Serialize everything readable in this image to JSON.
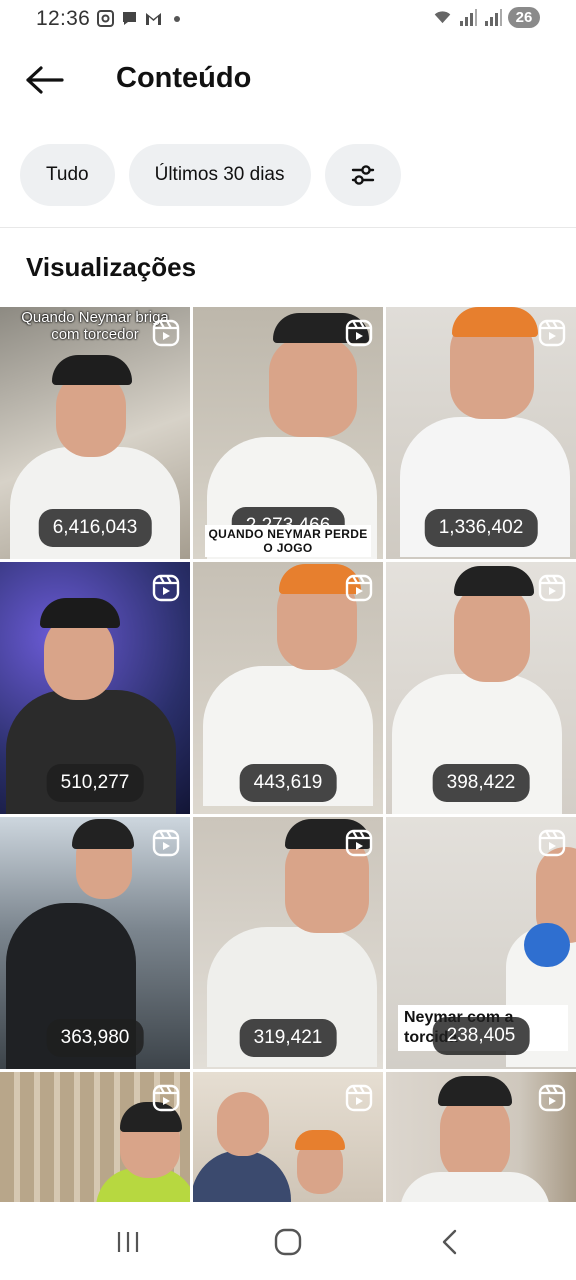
{
  "status_bar": {
    "time": "12:36",
    "battery": "26",
    "icons": [
      "screenshot-icon",
      "chat-icon",
      "gmail-icon",
      "wifi-icon",
      "signal-icon",
      "signal-icon"
    ]
  },
  "header": {
    "title": "Conteúdo",
    "back_icon": "arrow-left-icon"
  },
  "filters": {
    "all_label": "Tudo",
    "period_label": "Últimos 30 dias",
    "settings_icon": "sliders-icon"
  },
  "section": {
    "title": "Visualizações"
  },
  "tiles": [
    {
      "views": "6,416,043",
      "caption_top": "Quando Neymar briga com torcedor",
      "bg": "#b9b3a8"
    },
    {
      "views": "2,273,466",
      "caption_bottom": "QUANDO NEYMAR PERDE O JOGO",
      "bg": "#c9c3b7"
    },
    {
      "views": "1,336,402",
      "bg": "#d8d3cc"
    },
    {
      "views": "510,277",
      "bg": "#2a2f6a"
    },
    {
      "views": "443,619",
      "bg": "#cfc9be"
    },
    {
      "views": "398,422",
      "bg": "#dcd8d2"
    },
    {
      "views": "363,980",
      "bg": "#8c949c"
    },
    {
      "views": "319,421",
      "bg": "#d6d1c8"
    },
    {
      "views": "238,405",
      "caption_right": "Neymar  com a torcida",
      "bg": "#dddad4"
    },
    {
      "views": "",
      "bg": "#c2b39c"
    },
    {
      "views": "",
      "bg": "#d1c8bb"
    },
    {
      "views": "",
      "bg": "#d5cec5"
    }
  ],
  "nav": {
    "recents_icon": "recents-icon",
    "home_icon": "home-icon",
    "back_icon": "chevron-left-icon"
  }
}
